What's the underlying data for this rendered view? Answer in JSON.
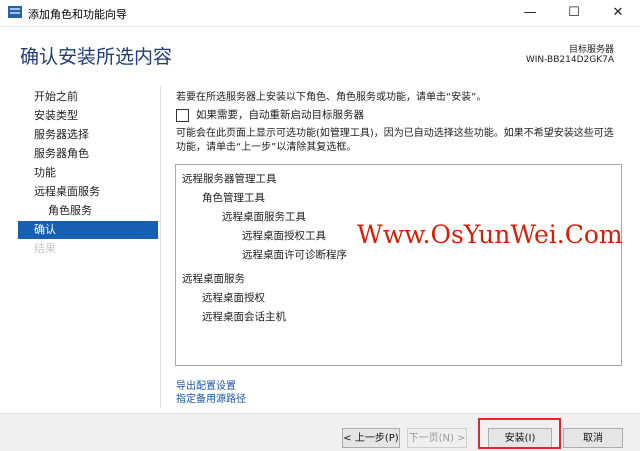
{
  "window": {
    "title": "添加角色和功能向导",
    "minimize_glyph": "—",
    "maximize_glyph": "☐",
    "close_glyph": "✕"
  },
  "header": {
    "page_title": "确认安装所选内容",
    "target_server_label": "目标服务器",
    "target_server_name": "WIN-BB214D2GK7A"
  },
  "nav": {
    "items": [
      {
        "label": "开始之前",
        "state": "normal"
      },
      {
        "label": "安装类型",
        "state": "normal"
      },
      {
        "label": "服务器选择",
        "state": "normal"
      },
      {
        "label": "服务器角色",
        "state": "normal"
      },
      {
        "label": "功能",
        "state": "normal"
      },
      {
        "label": "远程桌面服务",
        "state": "normal"
      },
      {
        "label": "角色服务",
        "state": "sub"
      },
      {
        "label": "确认",
        "state": "active"
      },
      {
        "label": "结果",
        "state": "disabled"
      }
    ]
  },
  "content": {
    "intro": "若要在所选服务器上安装以下角色、角色服务或功能，请单击“安装”。",
    "restart_checkbox": {
      "label": "如果需要，自动重新启动目标服务器",
      "checked": false
    },
    "description": "可能会在此页面上显示可选功能(如管理工具)，因为已自动选择这些功能。如果不希望安装这些可选功能，请单击“上一步”以清除其复选框。",
    "selection_list": [
      {
        "text": "远程服务器管理工具",
        "level": 0
      },
      {
        "text": "角色管理工具",
        "level": 1
      },
      {
        "text": "远程桌面服务工具",
        "level": 2
      },
      {
        "text": "远程桌面授权工具",
        "level": 3
      },
      {
        "text": "远程桌面许可诊断程序",
        "level": 3
      },
      {
        "text": "远程桌面服务",
        "level": 0
      },
      {
        "text": "远程桌面授权",
        "level": 1
      },
      {
        "text": "远程桌面会话主机",
        "level": 1
      }
    ],
    "export_link": "导出配置设置",
    "alt_source_link": "指定备用源路径"
  },
  "watermark": "Www.OsYunWei.Com",
  "footer": {
    "prev_label": "< 上一步(P)",
    "next_label": "下一页(N) >",
    "install_label": "安装(I)",
    "cancel_label": "取消"
  },
  "colors": {
    "accent": "#1560b2",
    "heading": "#1f3d7a",
    "link": "#1a54a8",
    "highlight": "#e3262c",
    "watermark": "#d81e06"
  }
}
